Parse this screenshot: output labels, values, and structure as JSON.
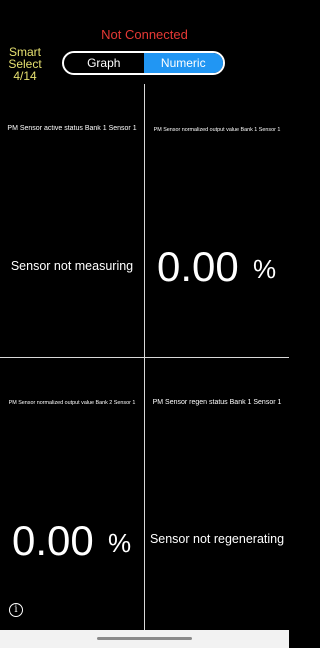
{
  "header": {
    "status": "Not Connected",
    "smart_select": {
      "line1": "Smart",
      "line2": "Select",
      "line3": "4/14"
    },
    "tabs": [
      {
        "label": "Graph",
        "active": false
      },
      {
        "label": "Numeric",
        "active": true
      }
    ]
  },
  "cells": [
    {
      "title": "PM Sensor active status Bank 1 Sensor 1",
      "value": "Sensor not measuring"
    },
    {
      "title": "PM Sensor normalized output value Bank 1 Sensor 1",
      "value": "0.00",
      "unit": "%"
    },
    {
      "title": "PM Sensor normalized output value Bank 2 Sensor 1",
      "value": "0.00",
      "unit": "%"
    },
    {
      "title": "PM Sensor regen status Bank 1 Sensor 1",
      "value": "Sensor not regenerating"
    }
  ],
  "footer": {
    "info_icon": "info-icon",
    "info_glyph": "i"
  },
  "colors": {
    "status": "#e53935",
    "smart_select": "#e6e070",
    "active_tab": "#2196f3",
    "background": "#000000"
  }
}
